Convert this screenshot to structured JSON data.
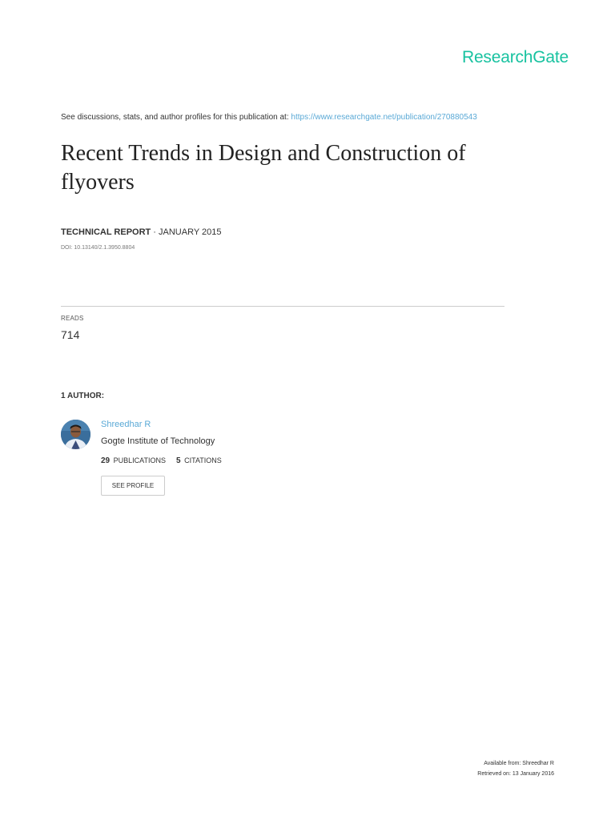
{
  "brand": "ResearchGate",
  "header": {
    "see_text": "See discussions, stats, and author profiles for this publication at: ",
    "url": "https://www.researchgate.net/publication/270880543"
  },
  "publication": {
    "title": "Recent Trends in Design and Construction of flyovers",
    "type": "TECHNICAL REPORT",
    "separator": " · ",
    "date": "JANUARY 2015",
    "doi": "DOI: 10.13140/2.1.3950.8804"
  },
  "reads": {
    "label": "READS",
    "value": "714"
  },
  "authors": {
    "heading": "1 AUTHOR:",
    "items": [
      {
        "name": "Shreedhar R",
        "institution": "Gogte Institute of Technology",
        "publications_count": "29",
        "publications_label": "PUBLICATIONS",
        "citations_count": "5",
        "citations_label": "CITATIONS",
        "button_label": "SEE PROFILE"
      }
    ]
  },
  "footer": {
    "available_from": "Available from: Shreedhar R",
    "retrieved_on": "Retrieved on: 13 January 2016"
  },
  "colors": {
    "brand": "#18c2a0",
    "link": "#5aa9d6"
  },
  "icons": {
    "avatar": "author-photo"
  }
}
